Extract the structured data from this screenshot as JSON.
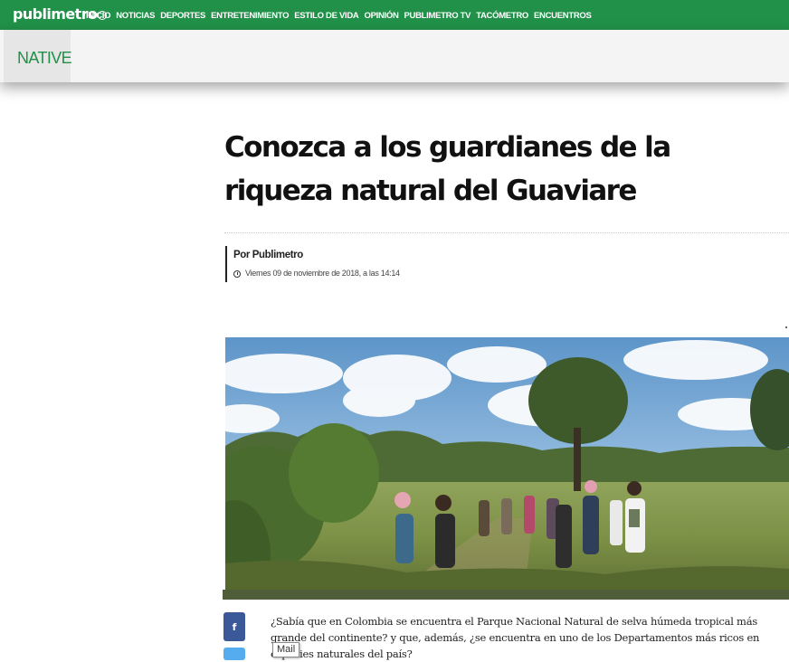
{
  "header": {
    "logo": "publimetro",
    "nav": [
      "INICIO",
      "NOTICIAS",
      "DEPORTES",
      "ENTRETENIMIENTO",
      "ESTILO DE VIDA",
      "OPINIÓN",
      "PUBLIMETRO TV",
      "TACÓMETRO",
      "ENCUENTROS"
    ]
  },
  "section": {
    "label": "NATIVE"
  },
  "article": {
    "title": "Conozca a los guardianes de la riqueza natural del Guaviare",
    "author": "Por Publimetro",
    "date": "Viernes 09 de noviembre de 2018, a las 14:14",
    "body": "¿Sabía que en Colombia se encuentra el Parque Nacional Natural de selva húmeda tropical más grande del continente? y que, además, ¿se encuentra en uno de los Departamentos más ricos en especies naturales del país?"
  },
  "share": {
    "facebook_glyph": "f"
  },
  "tooltip": {
    "mail": "Mail"
  },
  "colors": {
    "brand_green": "#219149",
    "facebook": "#3b5998",
    "twitter": "#55acee"
  }
}
